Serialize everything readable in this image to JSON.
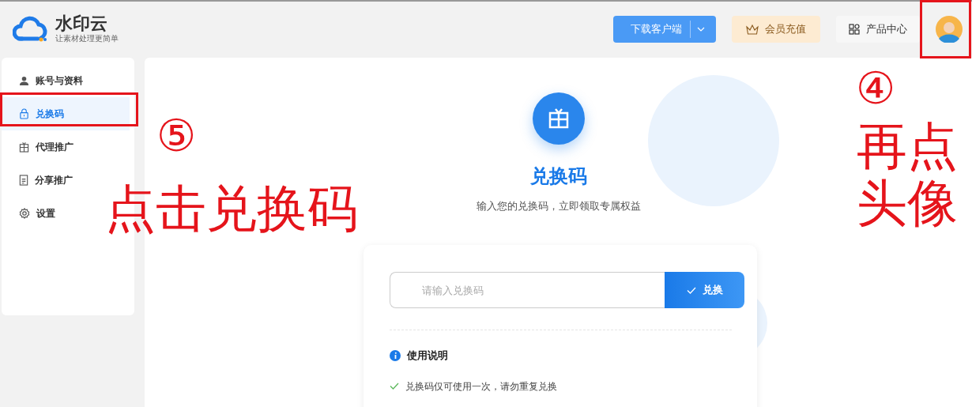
{
  "header": {
    "logo_title": "水印云",
    "logo_slogan": "让素材处理更简单",
    "download_button": "下载客户端",
    "vip_button": "会员充值",
    "products_button": "产品中心"
  },
  "sidebar": {
    "items": [
      {
        "label": "账号与资料",
        "selected": false
      },
      {
        "label": "兑换码",
        "selected": true
      },
      {
        "label": "代理推广",
        "selected": false
      },
      {
        "label": "分享推广",
        "selected": false
      },
      {
        "label": "设置",
        "selected": false
      }
    ]
  },
  "main": {
    "title": "兑换码",
    "subtitle": "输入您的兑换码，立即领取专属权益",
    "input": {
      "placeholder": "请输入兑换码"
    },
    "redeem_button": "兑换",
    "instructions": {
      "title": "使用说明",
      "items": [
        "兑换码仅可使用一次，请勿重复兑换"
      ]
    }
  },
  "annotations": [
    {
      "kind": "sidebar",
      "number": "⑤",
      "text": "点击兑换码"
    },
    {
      "kind": "avatar",
      "number": "④",
      "text": "再点头像"
    }
  ]
}
